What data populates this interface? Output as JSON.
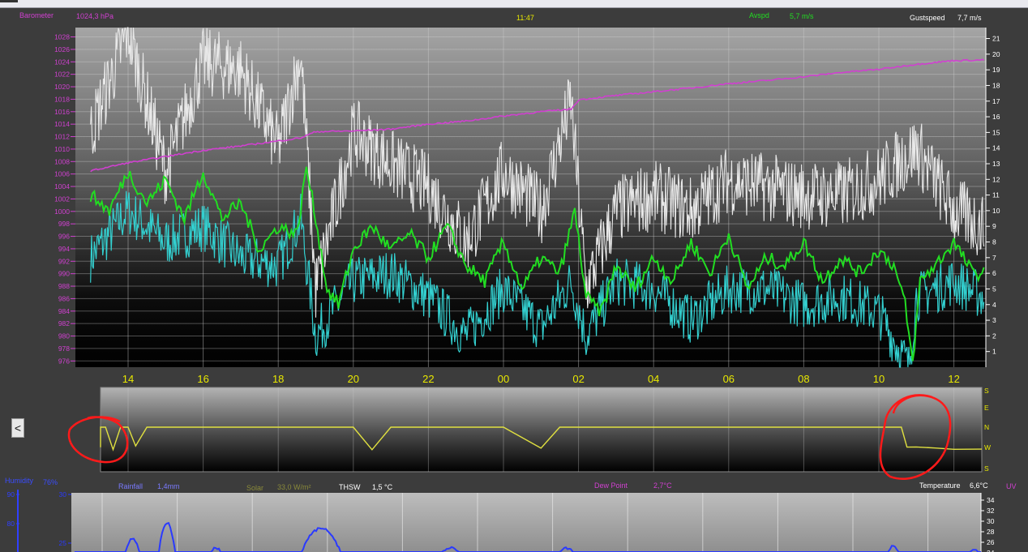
{
  "header": {
    "barometer_label": "Barometer",
    "barometer_value": "1024,3 hPa",
    "time": "11:47",
    "avg_speed_label": "Avspd",
    "avg_speed_value": "5,7 m/s",
    "gust_label": "Gustspeed",
    "gust_value": "7,7 m/s"
  },
  "lower_header": {
    "humidity_label": "Humidity",
    "humidity_value": "76%",
    "rainfall_label": "Rainfall",
    "rainfall_value": "1,4mm",
    "solar_label": "Solar",
    "solar_value": "33,0 W/m²",
    "thsw_label": "THSW",
    "thsw_value": "1,5 °C",
    "dewpoint_label": "Dew Point",
    "dewpoint_value": "2,7°C",
    "temperature_label": "Temperature",
    "temperature_value": "6,6°C",
    "uv_label": "UV"
  },
  "back_button": "<",
  "colors": {
    "barometer": "#d040d0",
    "avg_speed": "#22dd22",
    "gust": "#e8e8e8",
    "wind_min": "#33d0d0",
    "direction": "#e0e040",
    "axis_time": "#e8e800",
    "rain": "#2a3aff",
    "humidity": "#3040ff",
    "circle": "#ff1a1a"
  },
  "chart_data": [
    {
      "type": "line",
      "x_ticks": [
        "14",
        "16",
        "18",
        "20",
        "22",
        "00",
        "02",
        "04",
        "06",
        "08",
        "10",
        "12"
      ],
      "y_left_ticks": [
        1028,
        1026,
        1024,
        1022,
        1020,
        1018,
        1016,
        1014,
        1012,
        1010,
        1008,
        1006,
        1004,
        1002,
        1000,
        998,
        996,
        994,
        992,
        990,
        988,
        986,
        984,
        982,
        980,
        978,
        976
      ],
      "y_right_ticks": [
        21,
        20,
        19,
        18,
        17,
        16,
        15,
        14,
        13,
        12,
        11,
        10,
        9,
        8,
        7,
        6,
        5,
        4,
        3,
        2,
        1
      ],
      "ylim_left": [
        975,
        1029.5
      ],
      "ylim_right": [
        0,
        21.7
      ],
      "series": [
        {
          "name": "Barometer",
          "axis": "left",
          "x": [
            13.0,
            14.0,
            15.0,
            16.0,
            17.0,
            18.0,
            18.6,
            19.0,
            20.0,
            21.0,
            22.0,
            23.0,
            24.0,
            25.0,
            25.8,
            26.0,
            27.0,
            28.0,
            29.0,
            30.0,
            31.0,
            32.0,
            33.0,
            34.0,
            35.0,
            36.0,
            36.8
          ],
          "values": [
            1006.5,
            1007.8,
            1008.8,
            1009.8,
            1010.5,
            1011.3,
            1011.8,
            1012.8,
            1012.9,
            1013.2,
            1014.0,
            1014.5,
            1015.3,
            1016.0,
            1016.4,
            1017.9,
            1018.6,
            1019.2,
            1019.8,
            1020.5,
            1021.0,
            1021.6,
            1022.3,
            1022.8,
            1023.6,
            1024.2,
            1024.3
          ]
        },
        {
          "name": "Avspd",
          "axis": "right",
          "x": [
            13.0,
            13.5,
            14.0,
            14.5,
            15.0,
            15.5,
            16.0,
            16.5,
            17.0,
            17.5,
            18.0,
            18.5,
            18.75,
            19.0,
            19.3,
            19.6,
            20.0,
            20.5,
            21.0,
            21.5,
            22.0,
            22.5,
            23.0,
            23.5,
            24.0,
            24.5,
            25.0,
            25.5,
            25.9,
            26.2,
            26.6,
            27.0,
            27.5,
            28.0,
            28.5,
            29.0,
            29.5,
            30.0,
            30.5,
            31.0,
            31.5,
            32.0,
            32.5,
            33.0,
            33.5,
            34.0,
            34.4,
            34.7,
            34.9,
            35.1,
            35.5,
            36.0,
            36.5,
            36.8
          ],
          "values": [
            11.0,
            10.0,
            12.5,
            10.5,
            12.0,
            9.5,
            12.5,
            9.5,
            10.5,
            7.5,
            9.0,
            8.5,
            12.8,
            9.5,
            5.0,
            4.0,
            7.5,
            9.0,
            7.5,
            8.5,
            7.0,
            9.0,
            6.5,
            5.5,
            8.0,
            5.0,
            7.0,
            6.0,
            10.0,
            4.5,
            3.5,
            6.5,
            5.0,
            7.0,
            5.5,
            8.0,
            6.0,
            8.5,
            5.0,
            7.0,
            6.5,
            8.0,
            5.5,
            7.0,
            6.0,
            7.5,
            6.5,
            4.0,
            0.2,
            5.5,
            6.5,
            8.0,
            6.0,
            6.0
          ]
        },
        {
          "name": "Gustspeed",
          "axis": "right",
          "x": [
            13.0,
            14.0,
            15.0,
            16.0,
            17.0,
            18.0,
            18.6,
            19.0,
            20.0,
            21.0,
            22.0,
            23.0,
            24.0,
            25.0,
            25.8,
            26.2,
            27.0,
            28.0,
            29.0,
            30.0,
            31.0,
            32.0,
            33.0,
            34.0,
            35.0,
            36.0,
            36.8
          ],
          "values": [
            15.0,
            21.5,
            12.5,
            19.5,
            19.0,
            14.0,
            20.0,
            5.0,
            15.0,
            13.0,
            11.5,
            8.0,
            12.5,
            10.0,
            17.0,
            5.0,
            10.0,
            11.0,
            10.0,
            12.0,
            11.5,
            11.0,
            11.0,
            12.0,
            14.0,
            10.0,
            9.0
          ]
        },
        {
          "name": "Wind min",
          "axis": "right",
          "x": [
            13.0,
            14.0,
            15.0,
            16.0,
            17.0,
            18.0,
            18.6,
            19.0,
            20.0,
            21.0,
            22.0,
            23.0,
            24.0,
            25.0,
            25.8,
            26.2,
            27.0,
            28.0,
            29.0,
            30.0,
            31.0,
            32.0,
            33.0,
            34.0,
            34.8,
            35.0,
            36.0,
            36.8
          ],
          "values": [
            7.0,
            10.0,
            8.0,
            9.0,
            7.0,
            6.5,
            9.5,
            2.0,
            5.5,
            6.0,
            4.5,
            2.0,
            5.0,
            2.5,
            5.5,
            2.0,
            5.5,
            5.0,
            3.0,
            5.0,
            5.0,
            4.0,
            4.5,
            3.5,
            0.0,
            4.5,
            5.5,
            4.5
          ]
        }
      ]
    },
    {
      "type": "line",
      "y_right_ticks": [
        "S",
        "E",
        "N",
        "W",
        "S"
      ],
      "series": [
        {
          "name": "Wind direction",
          "x": [
            13.0,
            13.1,
            13.4,
            13.6,
            13.8,
            14.0,
            14.2,
            14.5,
            14.7,
            15.0,
            16.0,
            17.0,
            18.0,
            19.0,
            20.0,
            20.5,
            21.0,
            22.0,
            23.0,
            24.0,
            25.0,
            25.5,
            26.0,
            27.0,
            28.0,
            29.0,
            30.0,
            31.0,
            32.0,
            33.0,
            34.0,
            34.6,
            34.75,
            35.0,
            35.5,
            36.0,
            36.8
          ],
          "values": [
            "W",
            "N",
            "N",
            "W",
            "N",
            "N",
            "W",
            "N",
            "N",
            "N",
            "N",
            "N",
            "N",
            "N",
            "N",
            "W",
            "N",
            "N",
            "N",
            "N",
            "W",
            "N",
            "N",
            "N",
            "N",
            "N",
            "N",
            "N",
            "N",
            "N",
            "N",
            "N",
            "W",
            "W",
            "W",
            "W",
            "W"
          ]
        }
      ]
    },
    {
      "type": "line",
      "y_left_ticks": [
        90,
        80
      ],
      "y_left2_ticks": [
        30,
        25
      ],
      "y_right_ticks": [
        34,
        32,
        30,
        28,
        26,
        24
      ]
    }
  ]
}
